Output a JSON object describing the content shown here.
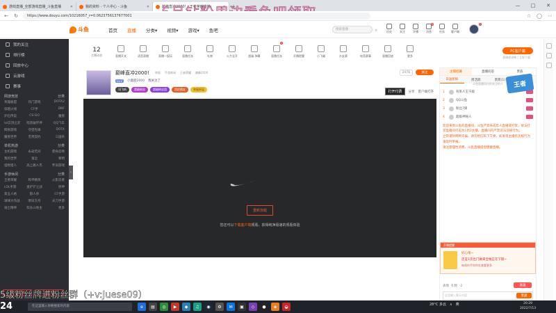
{
  "browser": {
    "tabs": [
      {
        "label": "游戏直播_全部游戏直播_斗鱼直播",
        "active": false
      },
      {
        "label": "我的资料 - 个人中心 - 斗鱼",
        "active": false
      },
      {
        "label": "巅峰直冲2000! - 王者荣耀直播",
        "active": true
      }
    ],
    "url": "https://www.douyu.com/10216057_r=0.0623756137677001",
    "win_controls": [
      "—",
      "□",
      "✕"
    ]
  },
  "overlay": {
    "top_text": "6月钻粉周边看鱼吧领取",
    "bottom_text": "5级粉丝牌进粉丝群（+v:Juese09）"
  },
  "topnav": {
    "logo_text": "斗鱼",
    "items": [
      "首页",
      "直播",
      "分类▾",
      "视频▾",
      "游戏▾",
      "鱼吧"
    ],
    "active_index": 1,
    "search_placeholder": "搜索直播",
    "icons": [
      {
        "label": "历史",
        "badge": ""
      },
      {
        "label": "关注",
        "badge": ""
      },
      {
        "label": "开播",
        "badge": ""
      },
      {
        "label": "消息",
        "badge": "3"
      },
      {
        "label": "任务",
        "badge": ""
      },
      {
        "label": "客户端",
        "badge": ""
      }
    ],
    "avatar_badge": "1"
  },
  "sidebar": {
    "top_items": [
      "我的关注",
      "排行榜",
      "回放中心",
      "云游戏",
      "赛事"
    ],
    "sections": [
      {
        "title": "网游竞技",
        "more": "分类",
        "items": [
          "英雄联盟",
          "热门游戏",
          "DOTA2",
          "穿越火线",
          "CF手",
          "DNF",
          "炉石传说",
          "CS:GO",
          "魔兽",
          "lol云顶之弈",
          "暗黑破坏神",
          "QQ飞车",
          "网易游戏",
          "守望先锋",
          "DOTA",
          "魔兽世界",
          "无畏契约",
          "三国杀"
        ]
      },
      {
        "title": "单机热游",
        "more": "分类",
        "items": [
          "主机游戏",
          "永劫无间",
          "使命召唤",
          "我的世界",
          "鬼泣",
          "黎明",
          "怪物猎人",
          "高上路人杰",
          "怀旧游戏"
        ]
      },
      {
        "title": "手游休闲",
        "more": "分类",
        "items": [
          "王者荣耀",
          "和平精英",
          "火影忍者",
          "LOL手游",
          "金铲铲之战",
          "原神",
          "第五人格",
          "狼人杀",
          "CF手游",
          "球球大作战",
          "明日方舟",
          "天刀手游",
          "骑士精神",
          "欢乐斗地主",
          "更多"
        ]
      }
    ],
    "bottom_buttons": [
      "客户端下载",
      "鱼吧下载"
    ]
  },
  "categories": {
    "count": "12",
    "count_label": "主播动态",
    "items": [
      {
        "label": "直播开关",
        "badge": ""
      },
      {
        "label": "语音直播",
        "badge": ""
      },
      {
        "label": "直播一起玩",
        "badge": ""
      },
      {
        "label": "直播任务",
        "badge": ""
      },
      {
        "label": "礼物",
        "badge": ""
      },
      {
        "label": "火力全开",
        "badge": ""
      },
      {
        "label": "超级 弹幕",
        "badge": ""
      },
      {
        "label": "直播任务",
        "badge": "1"
      },
      {
        "label": "开播提醒",
        "badge": ""
      },
      {
        "label": "小飞碟",
        "badge": ""
      },
      {
        "label": "水友赛",
        "badge": ""
      },
      {
        "label": "电竞赛事",
        "badge": ""
      },
      {
        "label": "直播回放",
        "badge": ""
      },
      {
        "label": "更多",
        "badge": ""
      }
    ],
    "pc_button": "PC客户端",
    "pc_sub": "直播更流畅 | 立即下载"
  },
  "room": {
    "title": "巅峰直冲2000!",
    "meta": [
      "举报",
      "手游休闲",
      "王者荣耀",
      "巅峰2000"
    ],
    "level": "Lv.2",
    "anchor": "小鹿鹿2000",
    "sub": "我关注了",
    "tags": [
      "讯飞听",
      "超级粉丝",
      "超级粉丝团",
      "回应朋友",
      "年轻好运"
    ],
    "follower_count": "2478",
    "follow_btn": "关注",
    "dakai": "打开付费",
    "actions": [
      "分享",
      "客户端打开"
    ]
  },
  "player": {
    "refresh_label": "重新加载",
    "hint_prefix": "您还可以",
    "hint_link": "下载客户端",
    "hint_suffix": "观看，获得纯净极速的观看体验"
  },
  "right_panel": {
    "tabs1": [
      "主播招募",
      "直播问答",
      "贵族"
    ],
    "tabs2": [
      "日送新鲜",
      "周活跃",
      "贵宾(1)",
      "粉丝"
    ],
    "rank": [
      {
        "n": "1",
        "name": "有系人王千殿"
      },
      {
        "n": "2",
        "name": "QQ斗鱼"
      },
      {
        "n": "3",
        "name": "粉丝7锋"
      },
      {
        "n": "4",
        "name": "超级神秘人"
      }
    ],
    "rank_tip": "斗鱼直播间内你关注的人",
    "chat": [
      "欢迎来到斗鱼的直播间，斗鱼严禁未成年人直播或打赏，依法打赏直播间打击为1到3主播。直播间内严禁违法违规行为。",
      "立刻谨防网络诈骗，请勿相信私下交易，如发现主播有违规行为请及时举报。",
      "请注意理性消费，斗鱼直播提倡健康直播。"
    ],
    "promo_head": "开播提醒",
    "promo_title": "好心侑~",
    "promo_sub": "还差1次出门做来宝做正在下期~",
    "promo_note": "每周你手你你在查看更多",
    "send_btn": "发送",
    "input_placeholder": "这里输入聊天内容",
    "footer_items": [
      "表情",
      "礼物",
      "-2"
    ]
  },
  "game_logo": "王者",
  "taskbar": {
    "time_big": "24",
    "search_placeholder": "在这里输入你要搜索的内容",
    "apps": [
      "e",
      "▤",
      "◎",
      "▶",
      "◆",
      "♫",
      "◉",
      "⚙",
      "✉",
      "▣",
      "◇",
      "●",
      "◈",
      "◒"
    ],
    "tray": [
      "28°C 多云",
      "∧",
      "英"
    ],
    "clock_time": "20:29",
    "clock_date": "2022/7/13"
  }
}
